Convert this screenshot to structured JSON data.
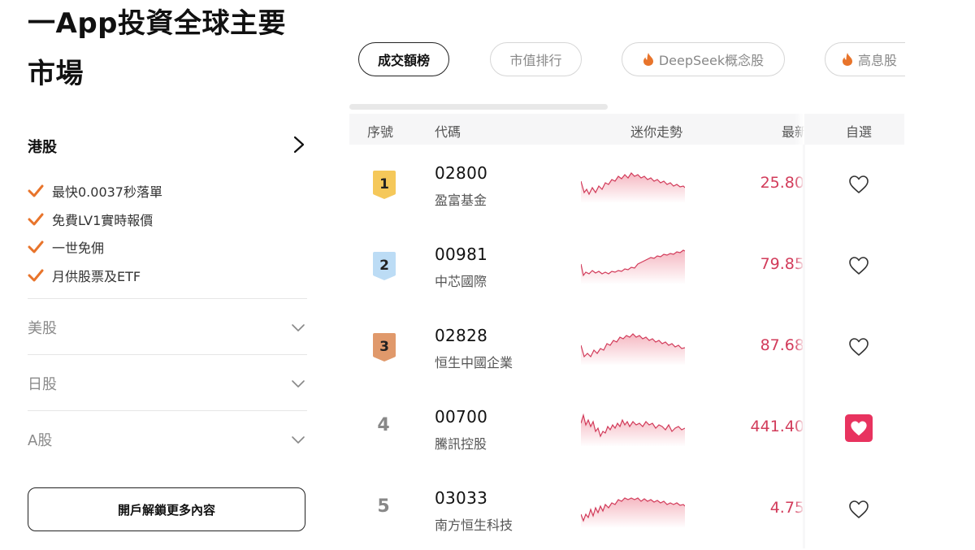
{
  "headline": {
    "line1": "一App投資全球主要",
    "line2": "市場"
  },
  "sections": {
    "hk": {
      "title": "港股",
      "features": [
        "最快0.0037秒落單",
        "免費LV1實時報價",
        "一世免佣",
        "月供股票及ETF"
      ]
    },
    "collapsed": [
      {
        "label": "美股"
      },
      {
        "label": "日股"
      },
      {
        "label": "A股"
      }
    ]
  },
  "open_account_label": "開戶解鎖更多內容",
  "chips": [
    {
      "label": "成交額榜",
      "active": true
    },
    {
      "label": "市值排行",
      "active": false
    },
    {
      "label": "DeepSeek概念股",
      "active": false,
      "icon": "flame-icon"
    },
    {
      "label": "高息股",
      "active": false,
      "icon": "flame-icon"
    }
  ],
  "table": {
    "headers": {
      "rank": "序號",
      "code": "代碼",
      "trend": "迷你走勢",
      "price": "最新",
      "watch": "自選"
    },
    "rows": [
      {
        "rank": "1",
        "code": "02800",
        "name": "盈富基金",
        "price": "25.80",
        "watched": false
      },
      {
        "rank": "2",
        "code": "00981",
        "name": "中芯國際",
        "price": "79.85",
        "watched": false
      },
      {
        "rank": "3",
        "code": "02828",
        "name": "恒生中國企業",
        "price": "87.68",
        "watched": false
      },
      {
        "rank": "4",
        "code": "00700",
        "name": "騰訊控股",
        "price": "441.40",
        "watched": true
      },
      {
        "rank": "5",
        "code": "03033",
        "name": "南方恒生科技",
        "price": "4.75",
        "watched": false
      }
    ]
  },
  "colors": {
    "accent_orange": "#e8742b",
    "price_red": "#d23b5a",
    "heart_active": "#e8335f",
    "rank1": "#f5c85a",
    "rank2": "#bcdcf5",
    "rank3": "#e0996b"
  }
}
